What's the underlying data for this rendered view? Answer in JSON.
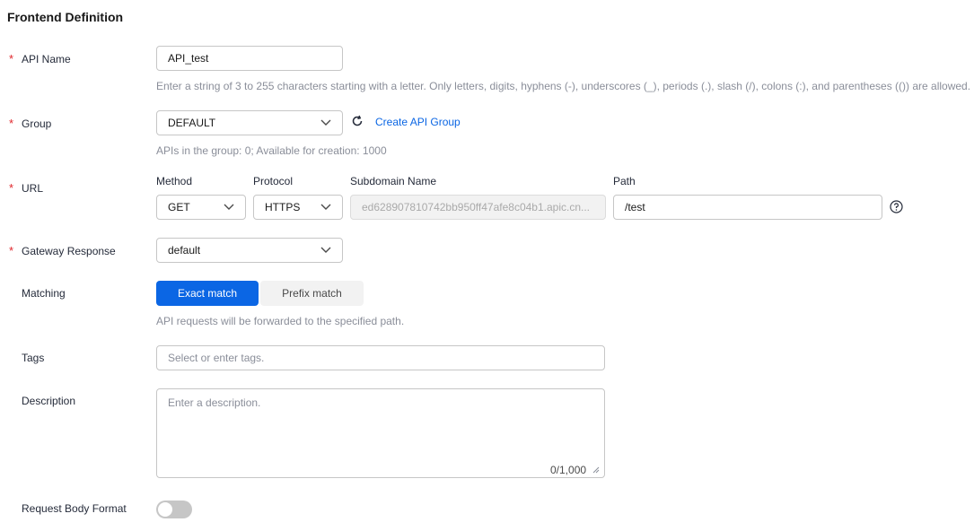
{
  "section_title": "Frontend Definition",
  "api_name": {
    "label": "API Name",
    "value": "API_test",
    "hint": "Enter a string of 3 to 255 characters starting with a letter. Only letters, digits, hyphens (-), underscores (_), periods (.), slash (/), colons (:), and parentheses (()) are allowed."
  },
  "group": {
    "label": "Group",
    "value": "DEFAULT",
    "create_link": "Create API Group",
    "hint": "APIs in the group: 0; Available for creation: 1000"
  },
  "url": {
    "label": "URL",
    "method_label": "Method",
    "method_value": "GET",
    "protocol_label": "Protocol",
    "protocol_value": "HTTPS",
    "subdomain_label": "Subdomain Name",
    "subdomain_value": "ed628907810742bb950ff47afe8c04b1.apic.cn...",
    "path_label": "Path",
    "path_value": "/test"
  },
  "gateway_response": {
    "label": "Gateway Response",
    "value": "default"
  },
  "matching": {
    "label": "Matching",
    "options": [
      "Exact match",
      "Prefix match"
    ],
    "selected": "Exact match",
    "hint": "API requests will be forwarded to the specified path."
  },
  "tags": {
    "label": "Tags",
    "placeholder": "Select or enter tags."
  },
  "description": {
    "label": "Description",
    "placeholder": "Enter a description.",
    "counter": "0/1,000"
  },
  "request_body_format": {
    "label": "Request Body Format",
    "enabled": false
  },
  "colors": {
    "primary": "#0b66e4",
    "required_star": "#e0262b"
  }
}
